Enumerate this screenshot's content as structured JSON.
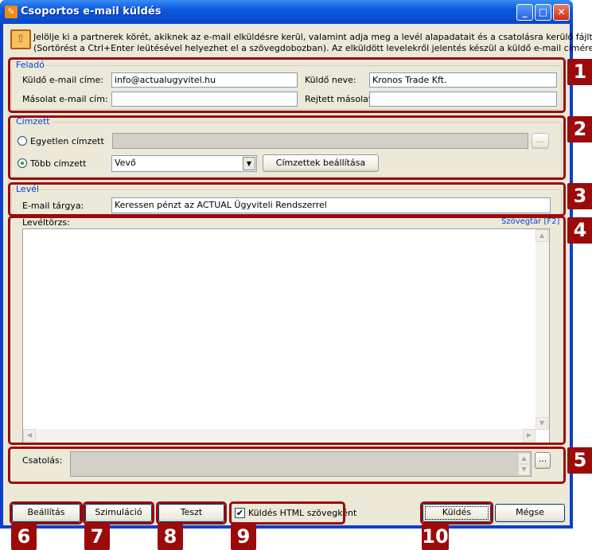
{
  "window": {
    "title": "Csoportos e-mail küldés",
    "controls": [
      "minimize",
      "maximize",
      "close"
    ]
  },
  "info": {
    "icon": "envelope-icon",
    "line1": "Jelölje ki a partnerek körét, akiknek az e-mail elküldésre kerül, valamint adja meg a levél alapadatait és a csatolásra kerülő fájlt",
    "line2": "(Sortörést a Ctrl+Enter leütésével helyezhet el a szövegdobozban). Az elküldött levelekről jelentés készül a küldő e-mail címére."
  },
  "sender": {
    "legend": "Feladó",
    "email_label": "Küldő e-mail címe:",
    "email_value": "info@actualugyvitel.hu",
    "name_label": "Küldő neve:",
    "name_value": "Kronos Trade Kft.",
    "cc_label": "Másolat e-mail cím:",
    "cc_value": "",
    "bcc_label": "Rejtett másolat:",
    "bcc_value": ""
  },
  "recipient": {
    "legend": "Címzett",
    "single_label": "Egyetlen címzett",
    "single_value": "",
    "multi_label": "Több címzett",
    "multi_selected": true,
    "group_value": "Vevő",
    "setup_button": "Címzettek beállítása",
    "browse": "..."
  },
  "letter": {
    "legend": "Levél",
    "subject_label": "E-mail tárgya:",
    "subject_value": "Keressen pénzt az ACTUAL Ügyviteli Rendszerrel"
  },
  "body": {
    "label": "Levéltörzs:",
    "library_link": "Szövegtár [F2]",
    "value": ""
  },
  "attachment": {
    "label": "Csatolás:",
    "browse": "..."
  },
  "footer": {
    "settings": "Beállítás",
    "simulation": "Szimuláció",
    "test": "Teszt",
    "html_checkbox": "Küldés HTML szövegként",
    "html_checked": true,
    "send": "Küldés",
    "cancel": "Mégse"
  },
  "badges": [
    "1",
    "2",
    "3",
    "4",
    "5",
    "6",
    "7",
    "8",
    "9",
    "10"
  ],
  "colors": {
    "callout": "#9c0a0a",
    "legend": "#0046d5",
    "titlebar": "#0a5ae0"
  }
}
